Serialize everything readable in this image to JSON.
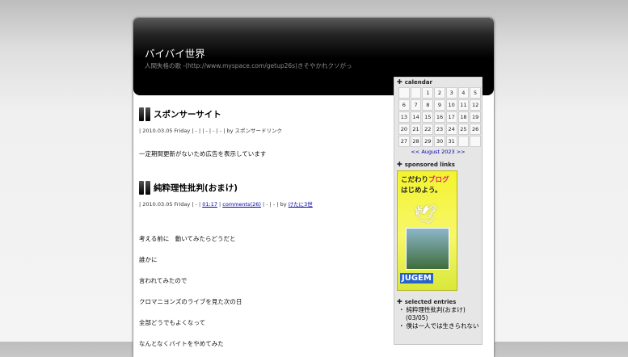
{
  "header": {
    "title": "バイバイ世界",
    "subtitle": "人間失格の歌 -(http://www.myspace.com/getup26s)きそやかれクソがっ"
  },
  "entries": [
    {
      "title": "スポンサーサイト",
      "meta_parts": [
        "| 2010.03.05 Friday | - | | - | - | - | by ",
        "スポンサードリンク"
      ],
      "body": [
        "一定期間更新がないため広告を表示しています"
      ]
    },
    {
      "title": "純粋理性批判(おまけ)",
      "meta_date": "| 2010.03.05 Friday | - | ",
      "meta_time": "01:17",
      "meta_comments": "comments(26)",
      "meta_rest": " | - | - | by ",
      "meta_author": "けたに3世",
      "body": [
        "考える前に　動いてみたらどうだと",
        "誰かに",
        "言われてみたので",
        "クロマニヨンズのライブを見た次の日",
        "全部どうでもよくなって",
        "なんとなくバイトをやめてみた"
      ]
    }
  ],
  "sidebar": {
    "calendar_heading": "calendar",
    "calendar_rows": [
      [
        "",
        "",
        "1",
        "2",
        "3",
        "4",
        "5"
      ],
      [
        "6",
        "7",
        "8",
        "9",
        "10",
        "11",
        "12"
      ],
      [
        "13",
        "14",
        "15",
        "16",
        "17",
        "18",
        "19"
      ],
      [
        "20",
        "21",
        "22",
        "23",
        "24",
        "25",
        "26"
      ],
      [
        "27",
        "28",
        "29",
        "30",
        "31",
        "",
        ""
      ]
    ],
    "calendar_nav": "<< August 2023 >>",
    "sponsored_heading": "sponsored links",
    "ad": {
      "line1_a": "こだわり",
      "line1_b": "ブログ",
      "line2": "はじめよう。",
      "brand": "JUGEM"
    },
    "selected_heading": "selected entries",
    "selected_entries": [
      "純粋理性批判(おまけ)",
      "(03/05)",
      "僕は一人では生きられない"
    ]
  }
}
